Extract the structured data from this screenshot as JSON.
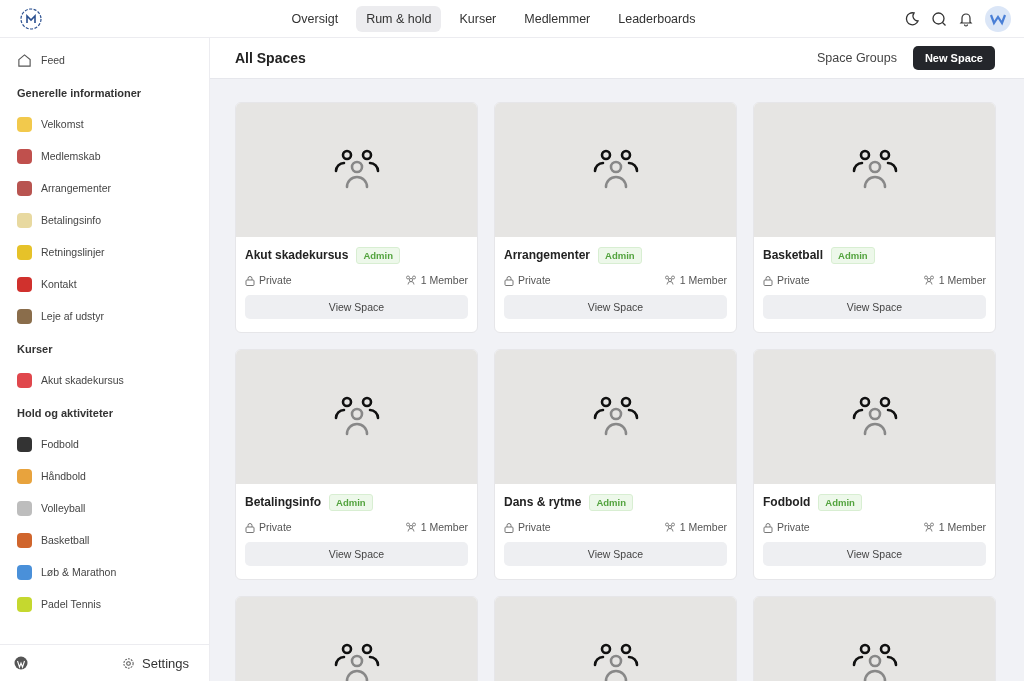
{
  "nav": {
    "tabs": [
      {
        "label": "Oversigt",
        "selected": false
      },
      {
        "label": "Rum & hold",
        "selected": true
      },
      {
        "label": "Kurser",
        "selected": false
      },
      {
        "label": "Medlemmer",
        "selected": false
      },
      {
        "label": "Leaderboards",
        "selected": false
      }
    ]
  },
  "sidebar": {
    "feed": "Feed",
    "sections": [
      {
        "title": "Generelle informationer",
        "items": [
          {
            "label": "Velkomst",
            "color": "#f2c94c"
          },
          {
            "label": "Medlemskab",
            "color": "#c0504d"
          },
          {
            "label": "Arrangementer",
            "color": "#b85450"
          },
          {
            "label": "Betalingsinfo",
            "color": "#e8d9a0"
          },
          {
            "label": "Retningslinjer",
            "color": "#e6c229"
          },
          {
            "label": "Kontakt",
            "color": "#d0312d"
          },
          {
            "label": "Leje af udstyr",
            "color": "#8a6d4b"
          }
        ]
      },
      {
        "title": "Kurser",
        "items": [
          {
            "label": "Akut skadekursus",
            "color": "#e0474c"
          }
        ]
      },
      {
        "title": "Hold og aktiviteter",
        "items": [
          {
            "label": "Fodbold",
            "color": "#333333"
          },
          {
            "label": "Håndbold",
            "color": "#e8a33d"
          },
          {
            "label": "Volleyball",
            "color": "#bdbdbd"
          },
          {
            "label": "Basketball",
            "color": "#d0652c"
          },
          {
            "label": "Løb & Marathon",
            "color": "#4a90d9"
          },
          {
            "label": "Padel Tennis",
            "color": "#c5d82f"
          }
        ]
      }
    ],
    "settings": "Settings"
  },
  "main": {
    "title": "All Spaces",
    "groups_link": "Space Groups",
    "new_button": "New Space"
  },
  "spaces": [
    {
      "kind": "full",
      "name": "Akut skadekursus",
      "badge": "Admin",
      "privacy": "Private",
      "members": "1 Member",
      "action": "View Space"
    },
    {
      "kind": "full",
      "name": "Arrangementer",
      "badge": "Admin",
      "privacy": "Private",
      "members": "1 Member",
      "action": "View Space"
    },
    {
      "kind": "full",
      "name": "Basketball",
      "badge": "Admin",
      "privacy": "Private",
      "members": "1 Member",
      "action": "View Space"
    },
    {
      "kind": "full",
      "name": "Betalingsinfo",
      "badge": "Admin",
      "privacy": "Private",
      "members": "1 Member",
      "action": "View Space"
    },
    {
      "kind": "full",
      "name": "Dans & rytme",
      "badge": "Admin",
      "privacy": "Private",
      "members": "1 Member",
      "action": "View Space"
    },
    {
      "kind": "full",
      "name": "Fodbold",
      "badge": "Admin",
      "privacy": "Private",
      "members": "1 Member",
      "action": "View Space"
    },
    {
      "kind": "cut"
    },
    {
      "kind": "cut"
    },
    {
      "kind": "cut"
    }
  ]
}
